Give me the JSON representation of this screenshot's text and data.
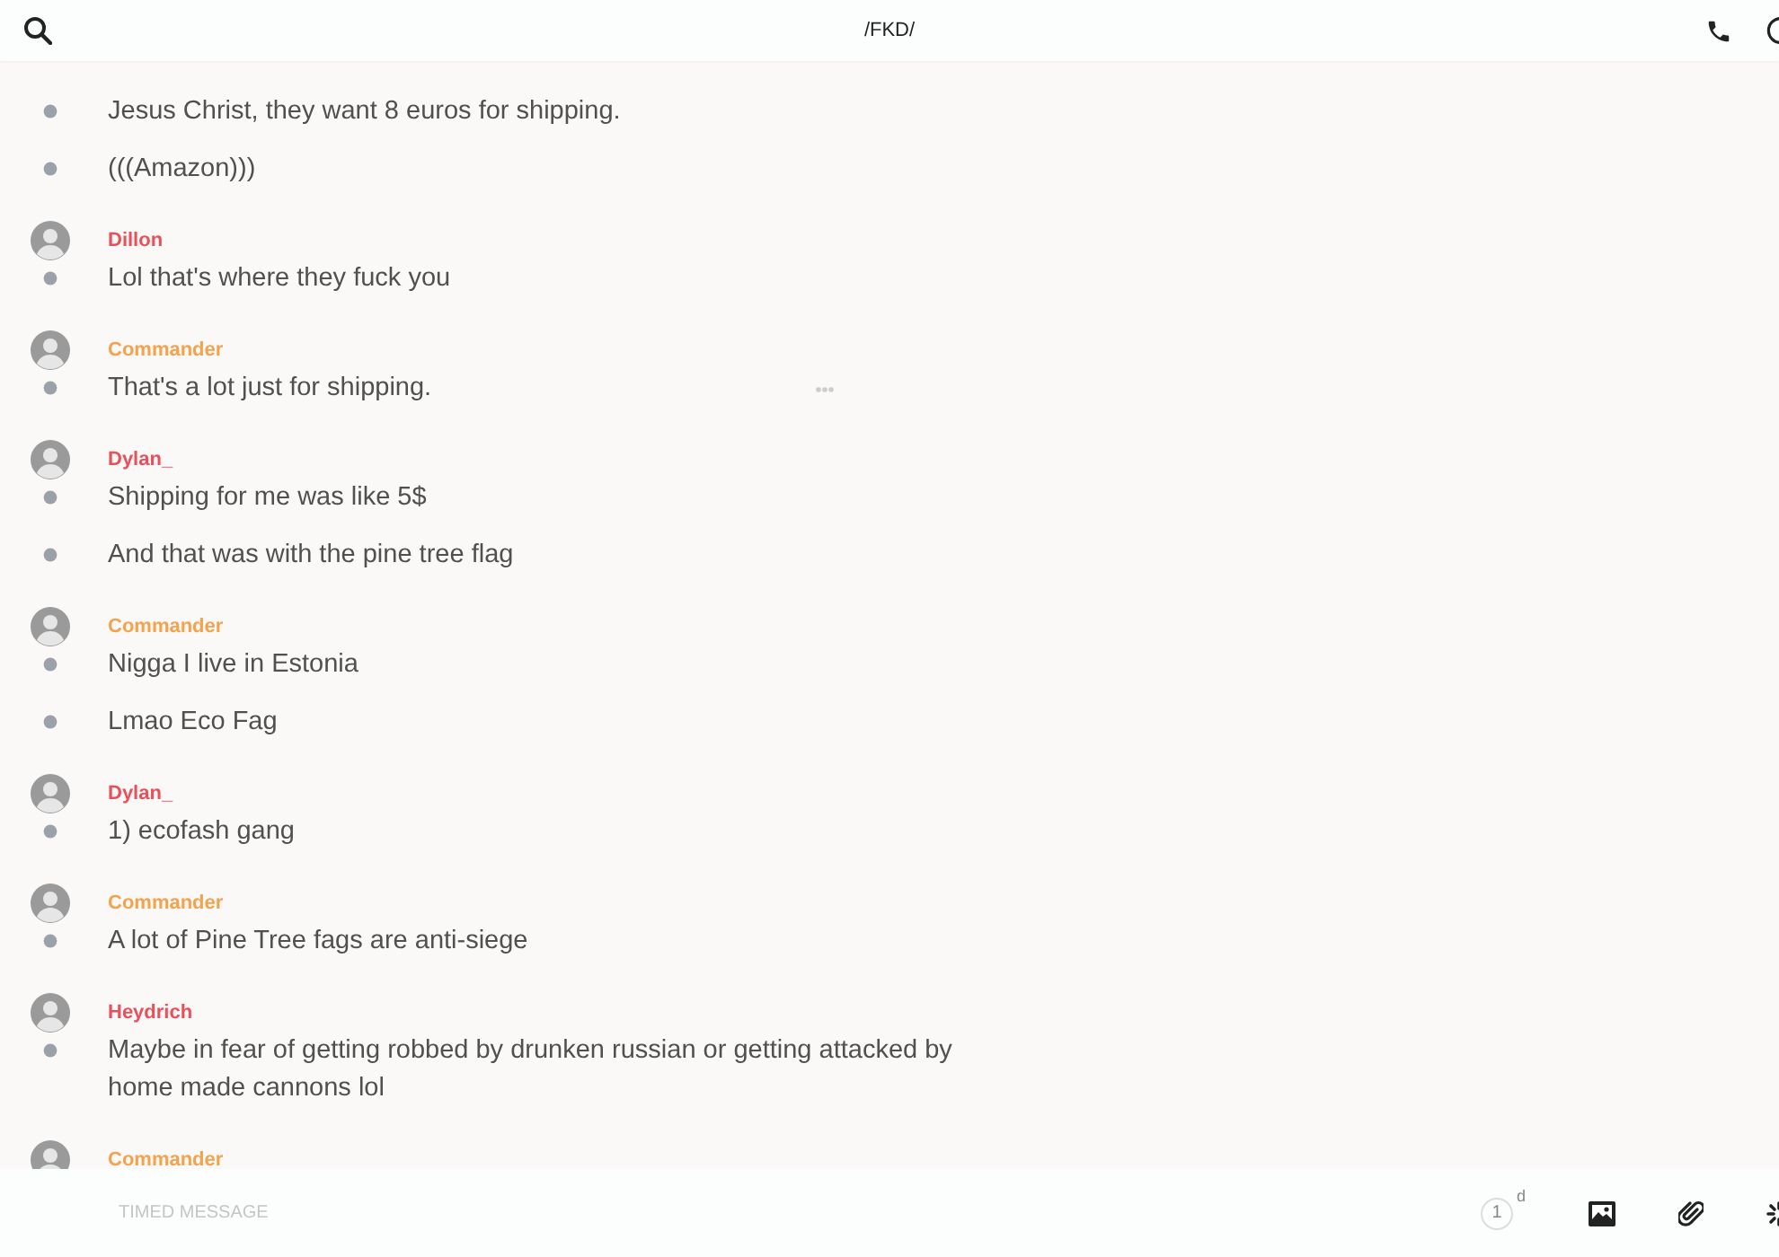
{
  "header": {
    "title": "/FKD/"
  },
  "groups": [
    {
      "lines": [
        {
          "text": "Jesus Christ, they want 8 euros for shipping."
        },
        {
          "text": "(((Amazon)))"
        }
      ]
    },
    {
      "author": "Dillon",
      "color": "#e9505a",
      "lines": [
        {
          "text": "Lol that's where they fuck you"
        }
      ]
    },
    {
      "author": "Commander",
      "color": "#f4a24c",
      "lines": [
        {
          "text": "That's a lot just for shipping.",
          "more": true
        }
      ]
    },
    {
      "author": "Dylan_",
      "color": "#e9505a",
      "lines": [
        {
          "text": "Shipping for me was like 5$"
        },
        {
          "text": "And that was with the pine tree flag"
        }
      ]
    },
    {
      "author": "Commander",
      "color": "#f4a24c",
      "lines": [
        {
          "text": "Nigga I live in Estonia"
        },
        {
          "text": "Lmao Eco Fag"
        }
      ]
    },
    {
      "author": "Dylan_",
      "color": "#e9505a",
      "lines": [
        {
          "text": "1) ecofash gang"
        }
      ]
    },
    {
      "author": "Commander",
      "color": "#f4a24c",
      "lines": [
        {
          "text": "A lot of Pine Tree fags are anti-siege"
        }
      ]
    },
    {
      "author": "Heydrich",
      "color": "#e9505a",
      "lines": [
        {
          "text": "Maybe in fear of getting robbed by drunken russian or getting attacked by home made cannons lol"
        }
      ]
    },
    {
      "author": "Commander",
      "color": "#f4a24c"
    }
  ],
  "composer": {
    "placeholder": "TIMED MESSAGE",
    "timer_value": "1",
    "timer_unit": "d"
  }
}
